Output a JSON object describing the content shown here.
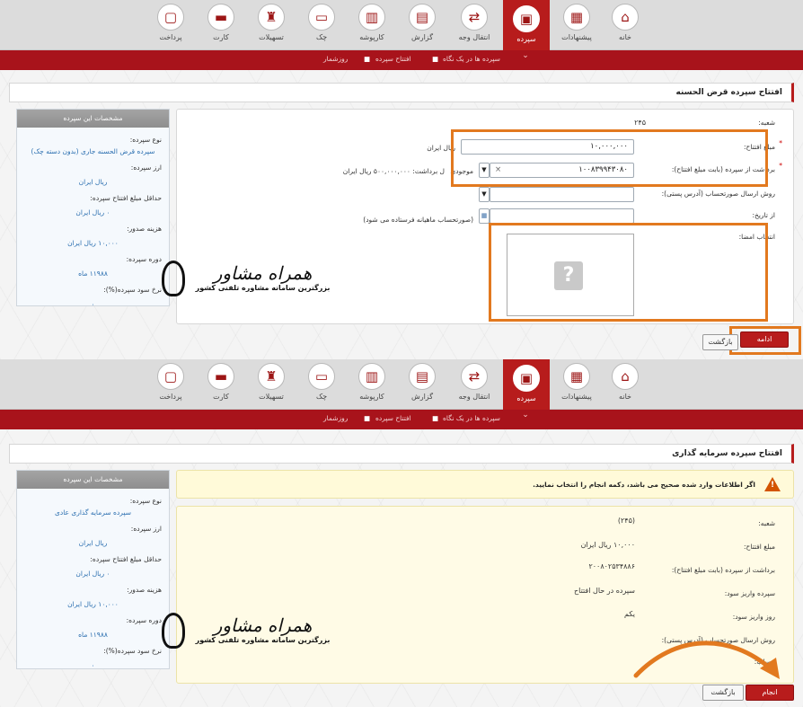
{
  "nav_items": [
    {
      "label": "خانه",
      "icon": "⌂"
    },
    {
      "label": "پیشنهادات",
      "icon": "▦"
    },
    {
      "label": "سپرده",
      "icon": "▣"
    },
    {
      "label": "انتقال وجه",
      "icon": "⇄"
    },
    {
      "label": "گزارش",
      "icon": "▤"
    },
    {
      "label": "کارپوشه",
      "icon": "▥"
    },
    {
      "label": "چک",
      "icon": "▭"
    },
    {
      "label": "تسهیلات",
      "icon": "♜"
    },
    {
      "label": "کارت",
      "icon": "▬"
    },
    {
      "label": "پرداخت",
      "icon": "▢"
    }
  ],
  "breadcrumb": {
    "item1": "سپرده ها در یک نگاه",
    "item2": "افتتاح سپرده",
    "item3": "روزشمار",
    "sep": "■"
  },
  "top": {
    "title": "افتتاح سپرده قرض الحسنه",
    "sidebar": {
      "header": "مشخصات این سپرده",
      "fields": [
        {
          "label": "نوع سپرده:",
          "value": "سپرده قرض الحسنه جاری (بدون دسته چک)"
        },
        {
          "label": "ارز سپرده:",
          "value": "ریال ایران"
        },
        {
          "label": "حداقل مبلغ افتتاح سپرده:",
          "value": "۰ ریال ایران"
        },
        {
          "label": "هزینه صدور:",
          "value": "۱۰,۰۰۰ ریال ایران"
        },
        {
          "label": "دوره سپرده:",
          "value": "۱۱۹۸۸ ماه"
        },
        {
          "label": "نرخ سود سپرده(%):",
          "value": "۰"
        }
      ]
    },
    "form": {
      "branch_label": "شعبه:",
      "branch_value": "۲۴۵",
      "amount_label": "مبلغ افتتاح:",
      "amount_value": "۱۰,۰۰۰,۰۰۰",
      "amount_unit": "ریال ایران",
      "withdraw_label": "برداشت از سپرده (بابت مبلغ افتتاح):",
      "withdraw_value": "۱۰۰۸۳۹۹۴۳۰۸۰",
      "balance_label": "موجودی",
      "withdrawable_text": "ل برداشت: ۵۰۰,۰۰۰,۰۰۰ ریال ایران",
      "statement_label": "روش ارسال صورتحساب (آدرس پستی):",
      "date_label": "از تاریخ:",
      "monthly_note": "(صورتحساب ماهیانه فرستاده می شود)",
      "signature_label": "انتخاب امضا:",
      "placeholder_glyph": "?"
    },
    "buttons": {
      "submit": "ادامه",
      "back": "بازگشت"
    }
  },
  "bottom": {
    "title": "افتتاح سپرده سرمایه گذاری",
    "notice": "اگر اطلاعات وارد شده صحیح می باشد، دکمه انجام را انتخاب نمایید.",
    "sidebar": {
      "header": "مشخصات این سپرده",
      "fields": [
        {
          "label": "نوع سپرده:",
          "value": "سپرده سرمایه گذاری عادی"
        },
        {
          "label": "ارز سپرده:",
          "value": "ریال ایران"
        },
        {
          "label": "حداقل مبلغ افتتاح سپرده:",
          "value": "۰ ریال ایران"
        },
        {
          "label": "هزینه صدور:",
          "value": "۱۰,۰۰۰ ریال ایران"
        },
        {
          "label": "دوره سپرده:",
          "value": "۱۱۹۸۸ ماه"
        },
        {
          "label": "نرخ سود سپرده(%):",
          "value": "۰"
        }
      ]
    },
    "summary": [
      {
        "label": "شعبه:",
        "value": "(۲۴۵)"
      },
      {
        "label": "مبلغ افتتاح:",
        "value": "۱۰,۰۰۰ ریال ایران"
      },
      {
        "label": "برداشت از سپرده (بابت مبلغ افتتاح):",
        "value": "۲۰۰۸۰۲۵۳۴۸۸۶"
      },
      {
        "label": "سپرده واریز سود:",
        "value": "سپرده در حال افتتاح"
      },
      {
        "label": "روز واریز سود:",
        "value": "یکم"
      },
      {
        "label": "روش ارسال صورتحساب (آدرس پستی):",
        "value": ""
      },
      {
        "label": "حساب:",
        "value": ""
      }
    ],
    "buttons": {
      "submit": "انجام",
      "back": "بازگشت"
    }
  },
  "watermark": {
    "title": "همراه مشاور",
    "subtitle": "بزرگترین سامانه مشاوره تلفنی کشور"
  },
  "colors": {
    "brand_red": "#b71c1c",
    "orange_highlight": "#e2791f",
    "link_blue": "#2b6fb0"
  }
}
